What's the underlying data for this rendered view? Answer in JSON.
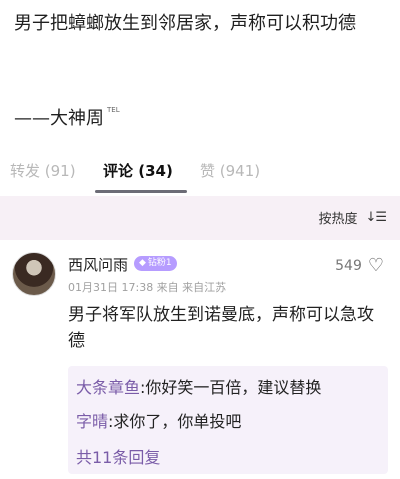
{
  "post": {
    "text": "男子把蟑螂放生到邻居家，声称可以积功德",
    "byline": "——大神周",
    "byline_sup": "TEL"
  },
  "tabs": [
    {
      "label": "转发 (91)"
    },
    {
      "label": "评论 (34)"
    },
    {
      "label": "赞 (941)"
    }
  ],
  "sort": {
    "label": "按热度",
    "icon": "sort-icon"
  },
  "comment": {
    "username": "西风问雨",
    "badge": "钻粉1",
    "meta": "01月31日 17:38 来自 来自江苏",
    "likes": "549",
    "body": "男子将军队放生到诺曼底，声称可以急攻德",
    "replies": [
      {
        "author": "大条章鱼",
        "text": ":你好笑一百倍，建议替换"
      },
      {
        "author": "字晴",
        "text": ":求你了，你单投吧"
      }
    ],
    "more": "共11条回复"
  },
  "colors": {
    "accent_purple": "#7a5ca8",
    "badge": "#b69cff",
    "band": "#f7f0f6"
  }
}
